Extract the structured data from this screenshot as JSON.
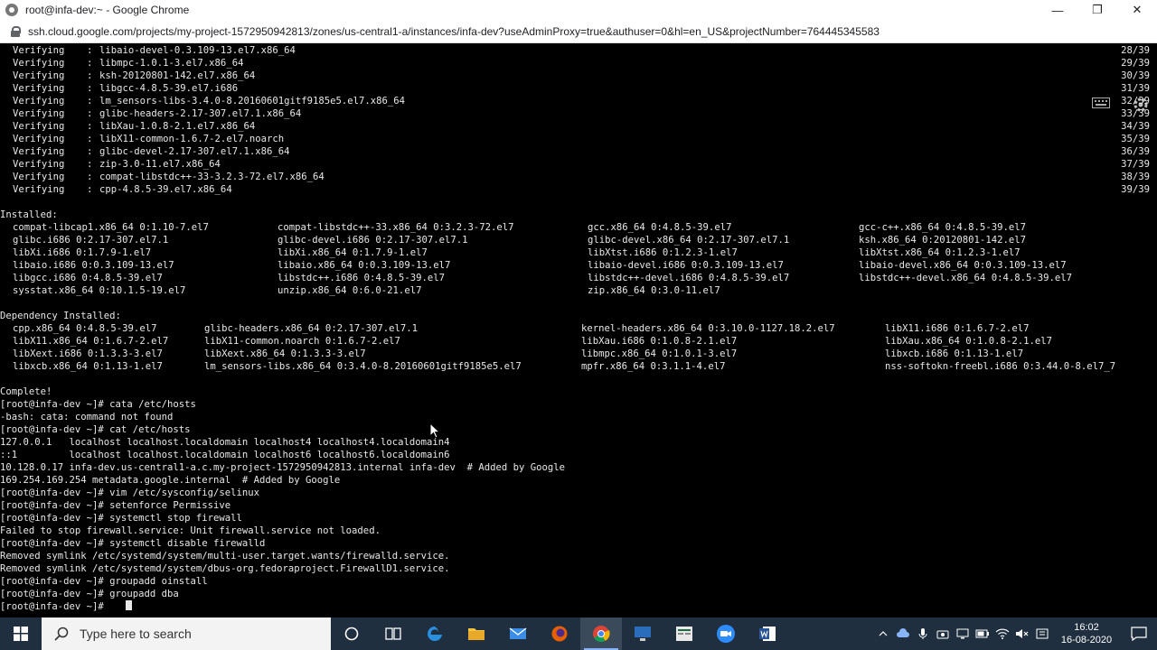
{
  "window": {
    "title": "root@infa-dev:~ - Google Chrome",
    "url": "ssh.cloud.google.com/projects/my-project-1572950942813/zones/us-central1-a/instances/infa-dev?useAdminProxy=true&authuser=0&hl=en_US&projectNumber=764445345583",
    "controls": {
      "minimize": "—",
      "maximize": "❐",
      "close": "✕"
    }
  },
  "terminal": {
    "verifying": [
      {
        "label": "Verifying",
        "pkg": "libaio-devel-0.3.109-13.el7.x86_64",
        "count": "28/39"
      },
      {
        "label": "Verifying",
        "pkg": "libmpc-1.0.1-3.el7.x86_64",
        "count": "29/39"
      },
      {
        "label": "Verifying",
        "pkg": "ksh-20120801-142.el7.x86_64",
        "count": "30/39"
      },
      {
        "label": "Verifying",
        "pkg": "libgcc-4.8.5-39.el7.i686",
        "count": "31/39"
      },
      {
        "label": "Verifying",
        "pkg": "lm_sensors-libs-3.4.0-8.20160601gitf9185e5.el7.x86_64",
        "count": "32/39"
      },
      {
        "label": "Verifying",
        "pkg": "glibc-headers-2.17-307.el7.1.x86_64",
        "count": "33/39"
      },
      {
        "label": "Verifying",
        "pkg": "libXau-1.0.8-2.1.el7.x86_64",
        "count": "34/39"
      },
      {
        "label": "Verifying",
        "pkg": "libX11-common-1.6.7-2.el7.noarch",
        "count": "35/39"
      },
      {
        "label": "Verifying",
        "pkg": "glibc-devel-2.17-307.el7.1.x86_64",
        "count": "36/39"
      },
      {
        "label": "Verifying",
        "pkg": "zip-3.0-11.el7.x86_64",
        "count": "37/39"
      },
      {
        "label": "Verifying",
        "pkg": "compat-libstdc++-33-3.2.3-72.el7.x86_64",
        "count": "38/39"
      },
      {
        "label": "Verifying",
        "pkg": "cpp-4.8.5-39.el7.x86_64",
        "count": "39/39"
      }
    ],
    "installed_header": "Installed:",
    "installed": [
      [
        "compat-libcap1.x86_64 0:1.10-7.el7",
        "compat-libstdc++-33.x86_64 0:3.2.3-72.el7",
        "gcc.x86_64 0:4.8.5-39.el7",
        "gcc-c++.x86_64 0:4.8.5-39.el7"
      ],
      [
        "glibc.i686 0:2.17-307.el7.1",
        "glibc-devel.i686 0:2.17-307.el7.1",
        "glibc-devel.x86_64 0:2.17-307.el7.1",
        "ksh.x86_64 0:20120801-142.el7"
      ],
      [
        "libXi.i686 0:1.7.9-1.el7",
        "libXi.x86_64 0:1.7.9-1.el7",
        "libXtst.i686 0:1.2.3-1.el7",
        "libXtst.x86_64 0:1.2.3-1.el7"
      ],
      [
        "libaio.i686 0:0.3.109-13.el7",
        "libaio.x86_64 0:0.3.109-13.el7",
        "libaio-devel.i686 0:0.3.109-13.el7",
        "libaio-devel.x86_64 0:0.3.109-13.el7"
      ],
      [
        "libgcc.i686 0:4.8.5-39.el7",
        "libstdc++.i686 0:4.8.5-39.el7",
        "libstdc++-devel.i686 0:4.8.5-39.el7",
        "libstdc++-devel.x86_64 0:4.8.5-39.el7"
      ],
      [
        "sysstat.x86_64 0:10.1.5-19.el7",
        "unzip.x86_64 0:6.0-21.el7",
        "zip.x86_64 0:3.0-11.el7",
        ""
      ]
    ],
    "dependency_header": "Dependency Installed:",
    "dependency": [
      [
        "cpp.x86_64 0:4.8.5-39.el7",
        "glibc-headers.x86_64 0:2.17-307.el7.1",
        "kernel-headers.x86_64 0:3.10.0-1127.18.2.el7",
        "libX11.i686 0:1.6.7-2.el7"
      ],
      [
        "libX11.x86_64 0:1.6.7-2.el7",
        "libX11-common.noarch 0:1.6.7-2.el7",
        "libXau.i686 0:1.0.8-2.1.el7",
        "libXau.x86_64 0:1.0.8-2.1.el7"
      ],
      [
        "libXext.i686 0:1.3.3-3.el7",
        "libXext.x86_64 0:1.3.3-3.el7",
        "libmpc.x86_64 0:1.0.1-3.el7",
        "libxcb.i686 0:1.13-1.el7"
      ],
      [
        "libxcb.x86_64 0:1.13-1.el7",
        "lm_sensors-libs.x86_64 0:3.4.0-8.20160601gitf9185e5.el7",
        "mpfr.x86_64 0:3.1.1-4.el7",
        "nss-softokn-freebl.i686 0:3.44.0-8.el7_7"
      ]
    ],
    "session": [
      "Complete!",
      "[root@infa-dev ~]# cata /etc/hosts",
      "-bash: cata: command not found",
      "[root@infa-dev ~]# cat /etc/hosts",
      "127.0.0.1   localhost localhost.localdomain localhost4 localhost4.localdomain4",
      "::1         localhost localhost.localdomain localhost6 localhost6.localdomain6",
      "10.128.0.17 infa-dev.us-central1-a.c.my-project-1572950942813.internal infa-dev  # Added by Google",
      "169.254.169.254 metadata.google.internal  # Added by Google",
      "[root@infa-dev ~]# vim /etc/sysconfig/selinux",
      "[root@infa-dev ~]# setenforce Permissive",
      "[root@infa-dev ~]# systemctl stop firewall",
      "Failed to stop firewall.service: Unit firewall.service not loaded.",
      "[root@infa-dev ~]# systemctl disable firewalld",
      "Removed symlink /etc/systemd/system/multi-user.target.wants/firewalld.service.",
      "Removed symlink /etc/systemd/system/dbus-org.fedoraproject.FirewallD1.service.",
      "[root@infa-dev ~]# groupadd oinstall",
      "[root@infa-dev ~]# groupadd dba",
      "[root@infa-dev ~]# "
    ]
  },
  "taskbar": {
    "search_placeholder": "Type here to search",
    "time": "16:02",
    "date": "16-08-2020",
    "colors": {
      "background": "#1f2f3f",
      "active": "#3a4a5a"
    }
  }
}
